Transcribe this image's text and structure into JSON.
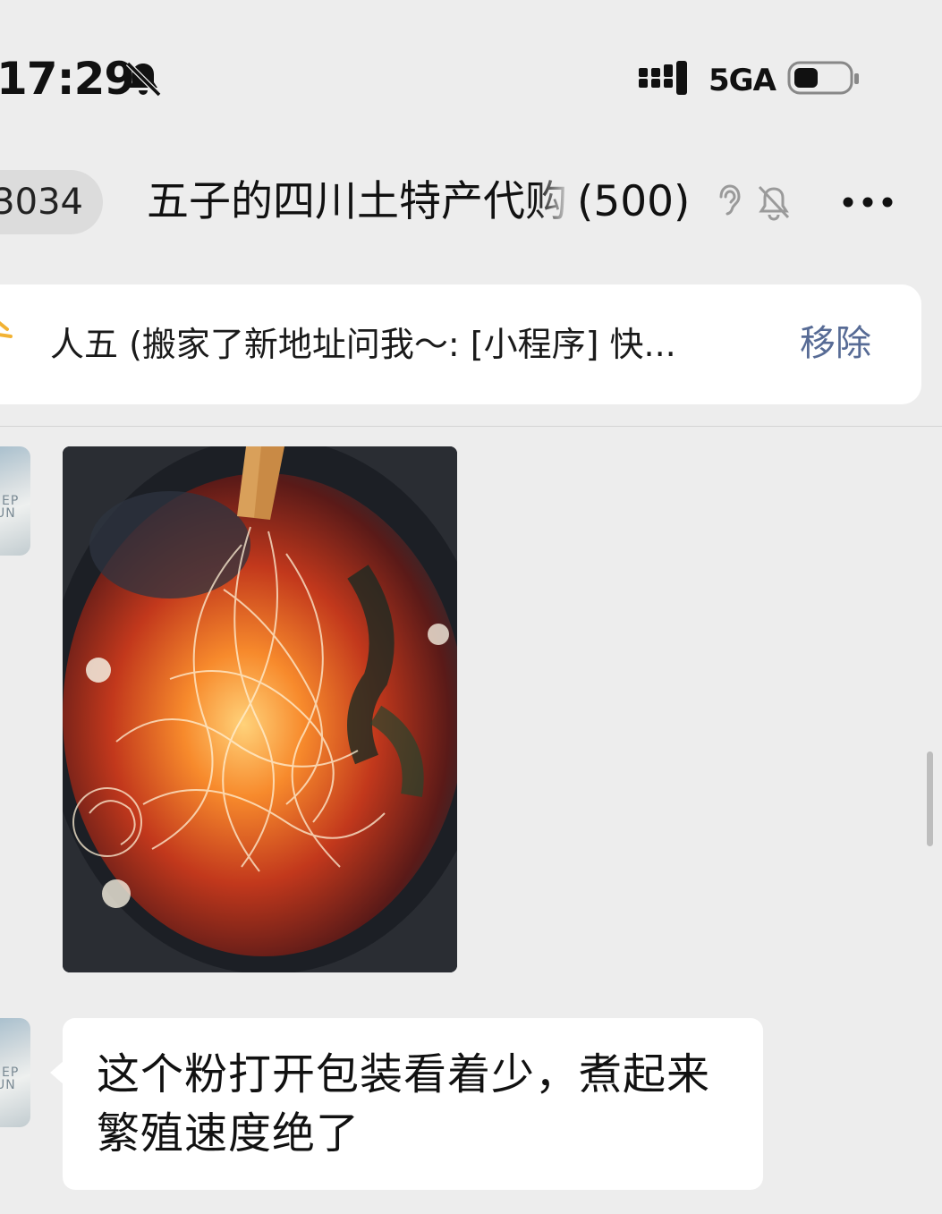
{
  "status_bar": {
    "time": "17:29",
    "network": "5GA",
    "icons": [
      "bell-off-icon",
      "signal-icon",
      "battery-icon"
    ]
  },
  "header": {
    "unread_count": "3034",
    "title": "五子的四川土特产代购",
    "member_count": "(500)",
    "icons": [
      "ear-icon",
      "mute-icon",
      "more-icon"
    ]
  },
  "pinned_banner": {
    "text": "人五 (搬家了新地址问我～: [小程序] 快...",
    "remove_label": "移除",
    "accent_color": "#576b95"
  },
  "messages": [
    {
      "type": "image",
      "description_icon": "food-photo"
    },
    {
      "type": "text",
      "lines": [
        "这个粉打开包装看着少，煮起来",
        "繁殖速度绝了"
      ]
    }
  ],
  "colors": {
    "background": "#ededed",
    "bubble": "#ffffff",
    "link": "#576b95"
  }
}
